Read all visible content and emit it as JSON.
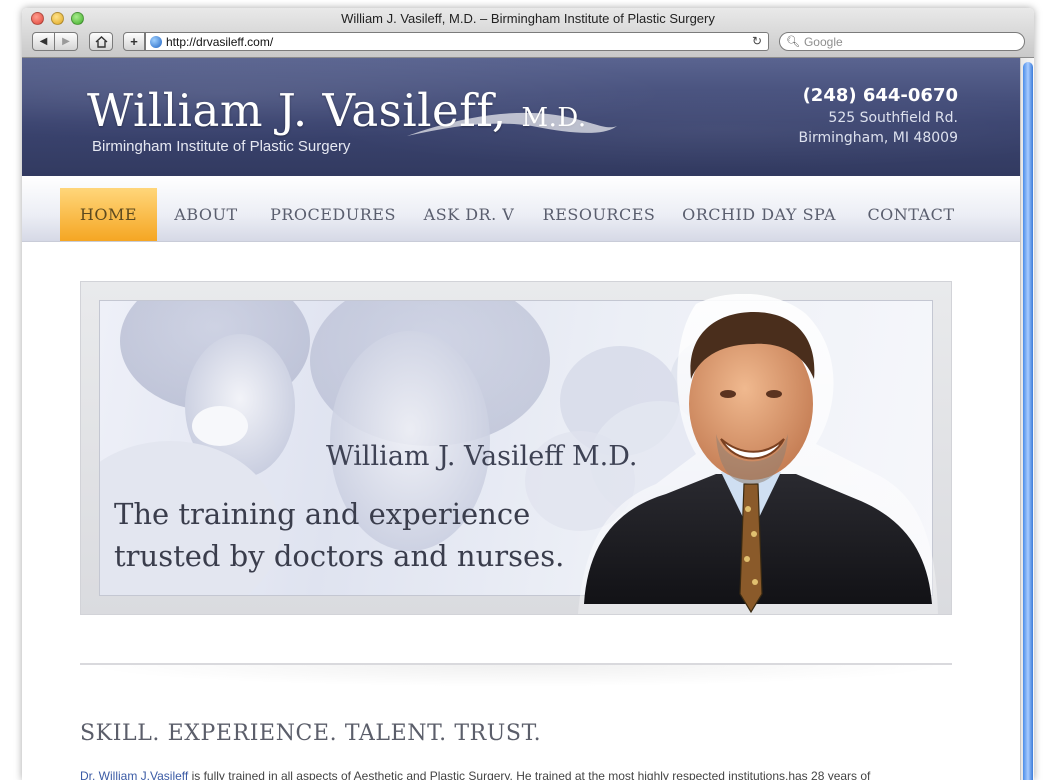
{
  "browser": {
    "window_title": "William J. Vasileff, M.D. – Birmingham Institute of Plastic Surgery",
    "url": "http://drvasileff.com/",
    "search_placeholder": "Google"
  },
  "site": {
    "logo_name": "William J. Vasileff,",
    "logo_md": "M.D.",
    "logo_subtitle": "Birmingham Institute of Plastic Surgery",
    "phone": "(248) 644-0670",
    "address_line1": "525 Southfield Rd.",
    "address_line2": "Birmingham, MI 48009"
  },
  "nav": {
    "items": [
      {
        "label": "HOME",
        "active": true
      },
      {
        "label": "ABOUT",
        "active": false
      },
      {
        "label": "PROCEDURES",
        "active": false
      },
      {
        "label": "ASK DR. V",
        "active": false
      },
      {
        "label": "RESOURCES",
        "active": false
      },
      {
        "label": "ORCHID DAY SPA",
        "active": false
      },
      {
        "label": "CONTACT",
        "active": false
      }
    ]
  },
  "hero": {
    "name": "William J. Vasileff M.D.",
    "tagline_line1": "The training and experience",
    "tagline_line2": "trusted by doctors and nurses."
  },
  "content": {
    "section_title": "SKILL. EXPERIENCE. TALENT. TRUST.",
    "intro_link": "Dr. William J.Vasileff",
    "intro_text": " is fully trained in all aspects of Aesthetic and Plastic Surgery. He trained at the most highly respected institutions,has 28 years of"
  },
  "colors": {
    "header_bg": "#3b4470",
    "nav_active": "#f5a623",
    "link": "#3b5ba5"
  }
}
